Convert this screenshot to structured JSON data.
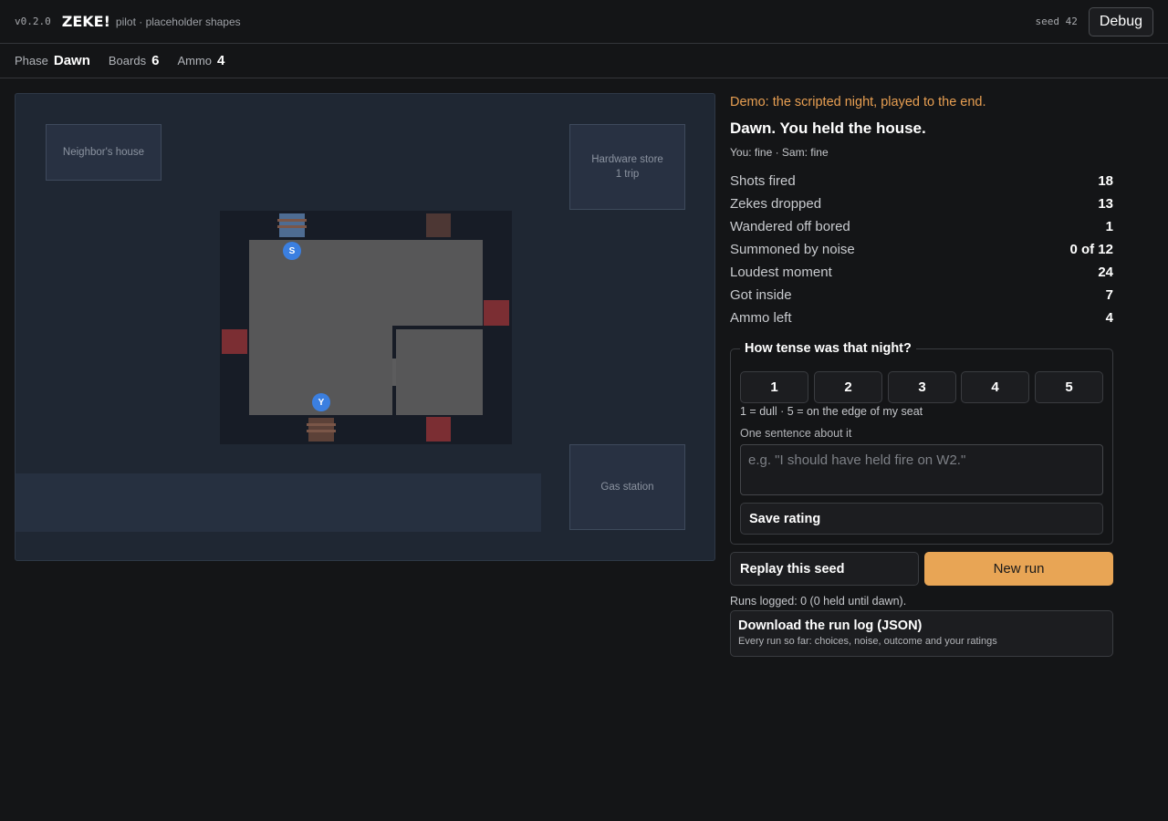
{
  "header": {
    "version": "v0.2.0",
    "title": "ZEKE!",
    "subtitle": "pilot · placeholder shapes",
    "seed": "seed 42",
    "debug_label": "Debug"
  },
  "status": {
    "phase_label": "Phase",
    "phase_value": "Dawn",
    "boards_label": "Boards",
    "boards_value": "6",
    "ammo_label": "Ammo",
    "ammo_value": "4"
  },
  "map": {
    "neighbor_house": "Neighbor's house",
    "hardware_store": "Hardware store",
    "hardware_store_trips": "1 trip",
    "gas_station": "Gas station",
    "player_token": "Y",
    "sam_token": "S"
  },
  "results": {
    "demo_note": "Demo: the scripted night, played to the end.",
    "headline": "Dawn. You held the house.",
    "health": "You: fine · Sam: fine",
    "stats": [
      {
        "label": "Shots fired",
        "value": "18"
      },
      {
        "label": "Zekes dropped",
        "value": "13"
      },
      {
        "label": "Wandered off bored",
        "value": "1"
      },
      {
        "label": "Summoned by noise",
        "value": "0 of 12"
      },
      {
        "label": "Loudest moment",
        "value": "24"
      },
      {
        "label": "Got inside",
        "value": "7"
      },
      {
        "label": "Ammo left",
        "value": "4"
      }
    ]
  },
  "rating": {
    "legend": "How tense was that night?",
    "options": [
      "1",
      "2",
      "3",
      "4",
      "5"
    ],
    "scale_note": "1 = dull · 5 = on the edge of my seat",
    "sentence_label": "One sentence about it",
    "sentence_placeholder": "e.g. \"I should have held fire on W2.\"",
    "save_label": "Save rating"
  },
  "actions": {
    "replay_label": "Replay this seed",
    "new_run_label": "New run",
    "runs_logged": "Runs logged: 0 (0 held until dawn).",
    "download_title": "Download the run log (JSON)",
    "download_sub": "Every run so far: choices, noise, outcome and your ratings"
  },
  "colors": {
    "accent": "#e8a555",
    "demo_text": "#e89f52",
    "token": "#3b7fe0",
    "damaged_window": "#7b2e33"
  }
}
